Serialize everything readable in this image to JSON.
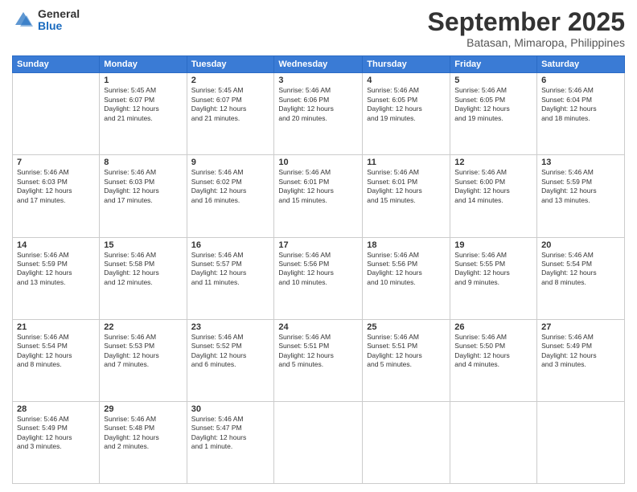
{
  "logo": {
    "general": "General",
    "blue": "Blue"
  },
  "header": {
    "month": "September 2025",
    "location": "Batasan, Mimaropa, Philippines"
  },
  "days_of_week": [
    "Sunday",
    "Monday",
    "Tuesday",
    "Wednesday",
    "Thursday",
    "Friday",
    "Saturday"
  ],
  "weeks": [
    [
      {
        "day": "",
        "info": ""
      },
      {
        "day": "1",
        "info": "Sunrise: 5:45 AM\nSunset: 6:07 PM\nDaylight: 12 hours\nand 21 minutes."
      },
      {
        "day": "2",
        "info": "Sunrise: 5:45 AM\nSunset: 6:07 PM\nDaylight: 12 hours\nand 21 minutes."
      },
      {
        "day": "3",
        "info": "Sunrise: 5:46 AM\nSunset: 6:06 PM\nDaylight: 12 hours\nand 20 minutes."
      },
      {
        "day": "4",
        "info": "Sunrise: 5:46 AM\nSunset: 6:05 PM\nDaylight: 12 hours\nand 19 minutes."
      },
      {
        "day": "5",
        "info": "Sunrise: 5:46 AM\nSunset: 6:05 PM\nDaylight: 12 hours\nand 19 minutes."
      },
      {
        "day": "6",
        "info": "Sunrise: 5:46 AM\nSunset: 6:04 PM\nDaylight: 12 hours\nand 18 minutes."
      }
    ],
    [
      {
        "day": "7",
        "info": "Sunrise: 5:46 AM\nSunset: 6:03 PM\nDaylight: 12 hours\nand 17 minutes."
      },
      {
        "day": "8",
        "info": "Sunrise: 5:46 AM\nSunset: 6:03 PM\nDaylight: 12 hours\nand 17 minutes."
      },
      {
        "day": "9",
        "info": "Sunrise: 5:46 AM\nSunset: 6:02 PM\nDaylight: 12 hours\nand 16 minutes."
      },
      {
        "day": "10",
        "info": "Sunrise: 5:46 AM\nSunset: 6:01 PM\nDaylight: 12 hours\nand 15 minutes."
      },
      {
        "day": "11",
        "info": "Sunrise: 5:46 AM\nSunset: 6:01 PM\nDaylight: 12 hours\nand 15 minutes."
      },
      {
        "day": "12",
        "info": "Sunrise: 5:46 AM\nSunset: 6:00 PM\nDaylight: 12 hours\nand 14 minutes."
      },
      {
        "day": "13",
        "info": "Sunrise: 5:46 AM\nSunset: 5:59 PM\nDaylight: 12 hours\nand 13 minutes."
      }
    ],
    [
      {
        "day": "14",
        "info": "Sunrise: 5:46 AM\nSunset: 5:59 PM\nDaylight: 12 hours\nand 13 minutes."
      },
      {
        "day": "15",
        "info": "Sunrise: 5:46 AM\nSunset: 5:58 PM\nDaylight: 12 hours\nand 12 minutes."
      },
      {
        "day": "16",
        "info": "Sunrise: 5:46 AM\nSunset: 5:57 PM\nDaylight: 12 hours\nand 11 minutes."
      },
      {
        "day": "17",
        "info": "Sunrise: 5:46 AM\nSunset: 5:56 PM\nDaylight: 12 hours\nand 10 minutes."
      },
      {
        "day": "18",
        "info": "Sunrise: 5:46 AM\nSunset: 5:56 PM\nDaylight: 12 hours\nand 10 minutes."
      },
      {
        "day": "19",
        "info": "Sunrise: 5:46 AM\nSunset: 5:55 PM\nDaylight: 12 hours\nand 9 minutes."
      },
      {
        "day": "20",
        "info": "Sunrise: 5:46 AM\nSunset: 5:54 PM\nDaylight: 12 hours\nand 8 minutes."
      }
    ],
    [
      {
        "day": "21",
        "info": "Sunrise: 5:46 AM\nSunset: 5:54 PM\nDaylight: 12 hours\nand 8 minutes."
      },
      {
        "day": "22",
        "info": "Sunrise: 5:46 AM\nSunset: 5:53 PM\nDaylight: 12 hours\nand 7 minutes."
      },
      {
        "day": "23",
        "info": "Sunrise: 5:46 AM\nSunset: 5:52 PM\nDaylight: 12 hours\nand 6 minutes."
      },
      {
        "day": "24",
        "info": "Sunrise: 5:46 AM\nSunset: 5:51 PM\nDaylight: 12 hours\nand 5 minutes."
      },
      {
        "day": "25",
        "info": "Sunrise: 5:46 AM\nSunset: 5:51 PM\nDaylight: 12 hours\nand 5 minutes."
      },
      {
        "day": "26",
        "info": "Sunrise: 5:46 AM\nSunset: 5:50 PM\nDaylight: 12 hours\nand 4 minutes."
      },
      {
        "day": "27",
        "info": "Sunrise: 5:46 AM\nSunset: 5:49 PM\nDaylight: 12 hours\nand 3 minutes."
      }
    ],
    [
      {
        "day": "28",
        "info": "Sunrise: 5:46 AM\nSunset: 5:49 PM\nDaylight: 12 hours\nand 3 minutes."
      },
      {
        "day": "29",
        "info": "Sunrise: 5:46 AM\nSunset: 5:48 PM\nDaylight: 12 hours\nand 2 minutes."
      },
      {
        "day": "30",
        "info": "Sunrise: 5:46 AM\nSunset: 5:47 PM\nDaylight: 12 hours\nand 1 minute."
      },
      {
        "day": "",
        "info": ""
      },
      {
        "day": "",
        "info": ""
      },
      {
        "day": "",
        "info": ""
      },
      {
        "day": "",
        "info": ""
      }
    ]
  ]
}
